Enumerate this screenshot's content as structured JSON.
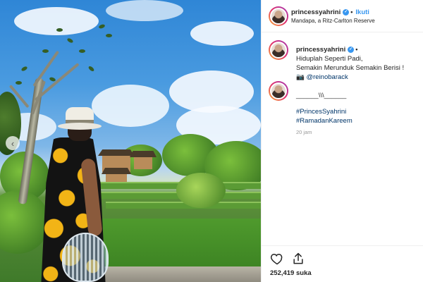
{
  "post": {
    "username": "princessyahrini",
    "follow_label": "Ikuti",
    "location": "Mandapa, a Ritz-Carlton Reserve",
    "caption_lines": [
      "Hiduplah Seperti Padi,",
      "Semakin Merunduk Semakin Berisi !"
    ],
    "camera_emoji": "📷",
    "mention": "@reinobarack",
    "comment_text": "______\\\\\\______",
    "hashtags": [
      "#PrincesSyahrini",
      "#RamadanKareem"
    ],
    "time_ago": "20 jam",
    "likes_text": "252,419 suka"
  },
  "icons": {
    "verified": "verified-badge-icon",
    "like": "heart-icon",
    "share": "share-icon",
    "prev": "chevron-left-icon"
  },
  "colors": {
    "link": "#3897f0",
    "hashtag": "#003569",
    "muted": "#999999",
    "text": "#262626"
  }
}
